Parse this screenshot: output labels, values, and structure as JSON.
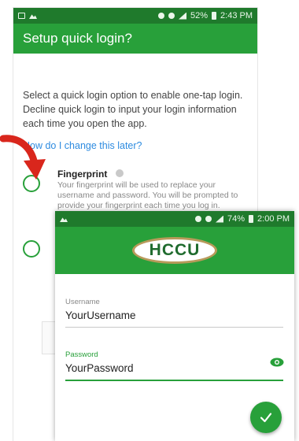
{
  "back_screen": {
    "status": {
      "battery_pct": "52%",
      "time": "2:43 PM"
    },
    "title": "Setup quick login?",
    "intro": "Select a quick login option to enable one-tap login. Decline quick login to input your login information each time you open the app.",
    "help_link": "How do I change this later?",
    "fingerprint": {
      "title": "Fingerprint",
      "description": "Your fingerprint will be used to replace your username and password.  You will be prompted to provide your fingerprint each time you log in."
    }
  },
  "front_screen": {
    "status": {
      "battery_pct": "74%",
      "time": "2:00 PM"
    },
    "logo_text": "HCCU",
    "username": {
      "label": "Username",
      "value": "YourUsername"
    },
    "password": {
      "label": "Password",
      "value": "YourPassword"
    }
  },
  "colors": {
    "brand_green": "#28a03a",
    "status_green": "#1f7a2c",
    "link_blue": "#2d8be0",
    "arrow_red": "#d9261c",
    "logo_gold": "#b89a5a"
  },
  "icons": {
    "arrow": "curved-arrow-icon",
    "eye": "eye-icon",
    "fab": "check-icon"
  }
}
